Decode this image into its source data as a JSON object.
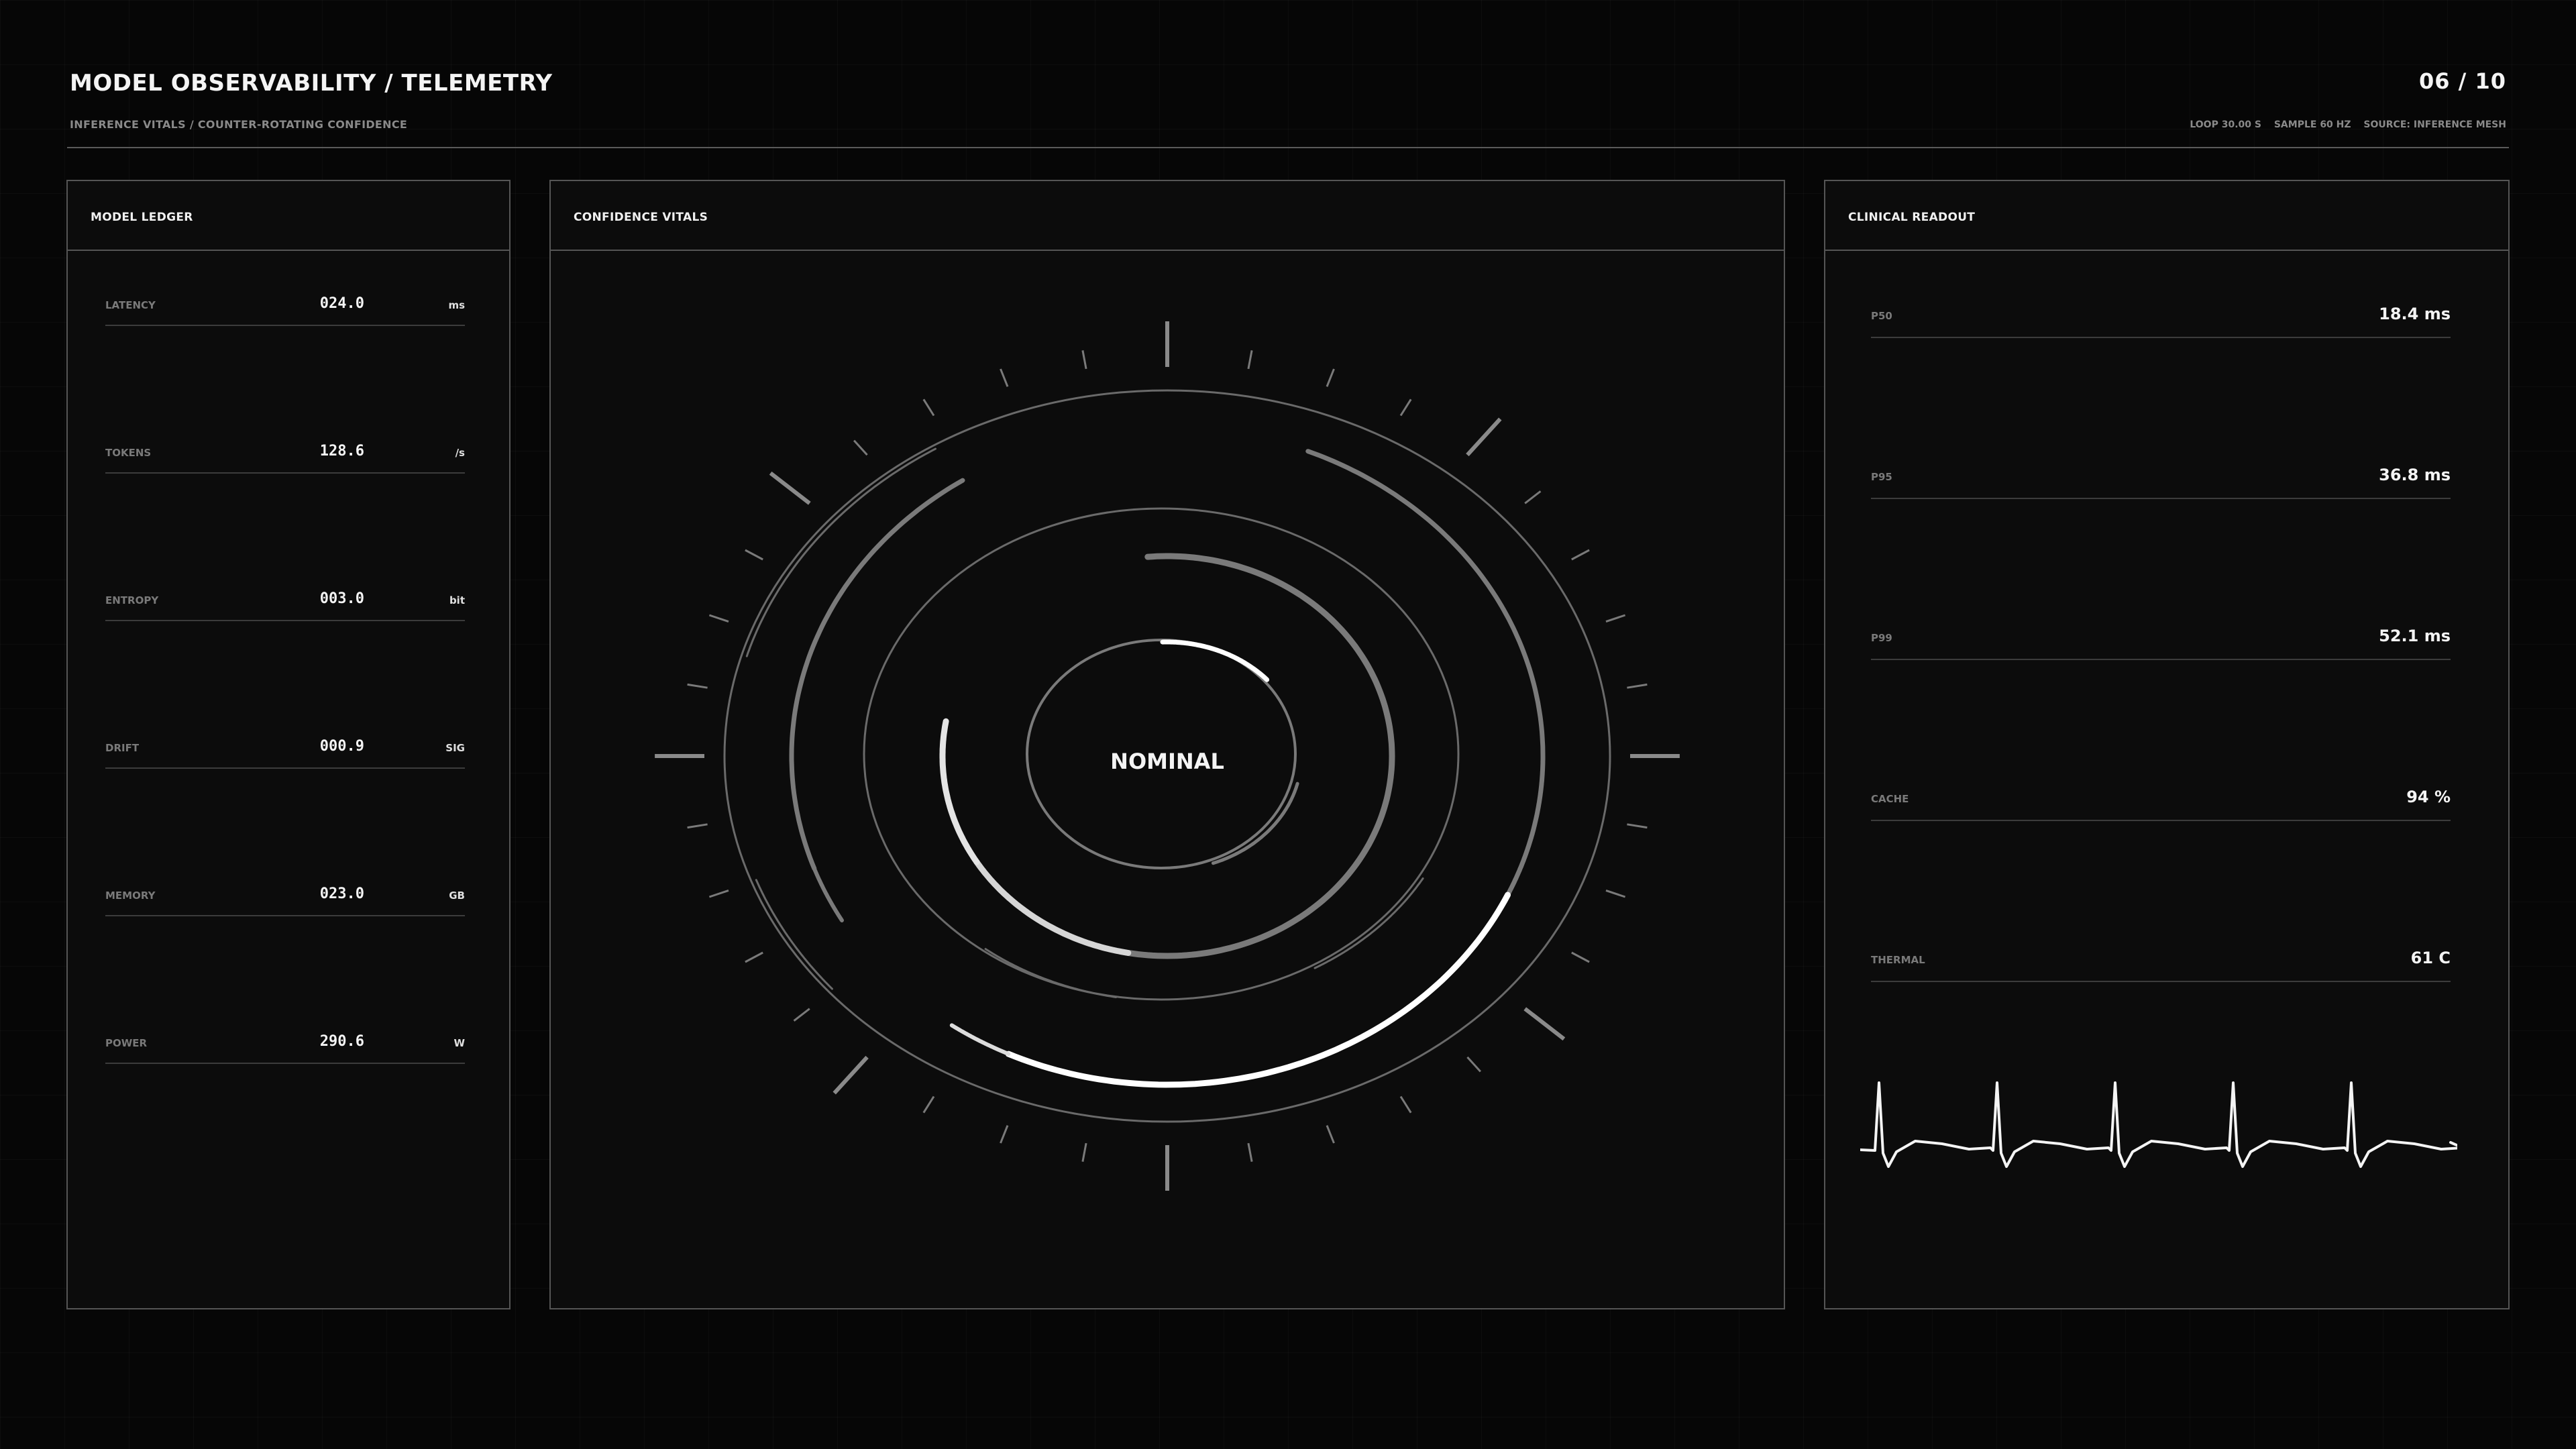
{
  "header": {
    "title": "MODEL OBSERVABILITY / TELEMETRY",
    "subtitle": "INFERENCE VITALS / COUNTER-ROTATING CONFIDENCE",
    "page_counter": "06 / 10",
    "meta": {
      "loop": "LOOP 30.00 S",
      "sample": "SAMPLE 60 HZ",
      "source": "SOURCE: INFERENCE MESH"
    }
  },
  "ledger": {
    "title": "MODEL LEDGER",
    "rows": [
      {
        "label": "LATENCY",
        "value": "024.0",
        "unit": "ms"
      },
      {
        "label": "TOKENS",
        "value": "128.6",
        "unit": "/s"
      },
      {
        "label": "ENTROPY",
        "value": "003.0",
        "unit": "bit"
      },
      {
        "label": "DRIFT",
        "value": "000.9",
        "unit": "SIG"
      },
      {
        "label": "MEMORY",
        "value": "023.0",
        "unit": "GB"
      },
      {
        "label": "POWER",
        "value": "290.6",
        "unit": "W"
      }
    ]
  },
  "vitals": {
    "title": "CONFIDENCE VITALS",
    "status": "NOMINAL"
  },
  "readout": {
    "title": "CLINICAL READOUT",
    "rows": [
      {
        "label": "P50",
        "value": "18.4 ms"
      },
      {
        "label": "P95",
        "value": "36.8 ms"
      },
      {
        "label": "P99",
        "value": "52.1 ms"
      },
      {
        "label": "CACHE",
        "value": "94 %"
      },
      {
        "label": "THERMAL",
        "value": "61 C"
      }
    ]
  },
  "colors": {
    "background": "#060606",
    "panel": "#0c0c0c",
    "border": "#555555",
    "text": "#f4f4f4",
    "muted": "#7a7a7a"
  }
}
